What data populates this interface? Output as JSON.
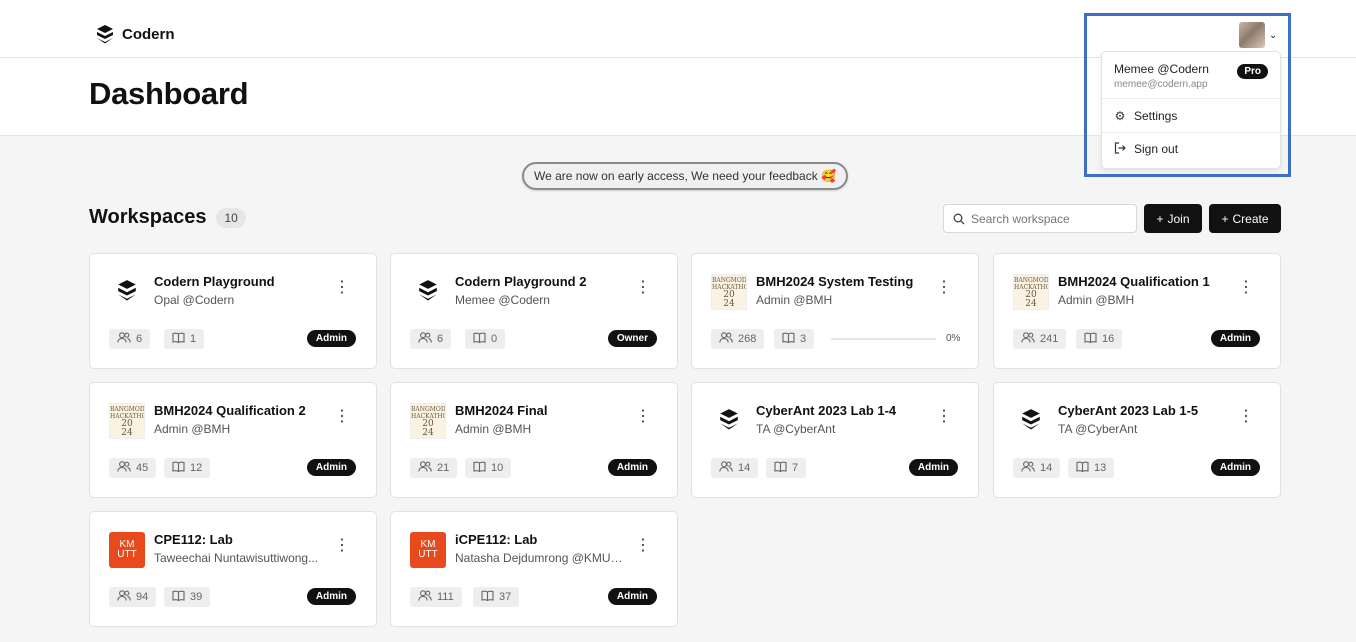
{
  "app": {
    "name": "Codern"
  },
  "page": {
    "title": "Dashboard"
  },
  "user_menu": {
    "name": "Memee @Codern",
    "email": "memee@codern.app",
    "badge": "Pro",
    "items": [
      {
        "label": "Settings",
        "icon": "gear-icon"
      },
      {
        "label": "Sign out",
        "icon": "sign-out-icon"
      }
    ]
  },
  "banner": {
    "text": "We are now on early access, We need your feedback 🥰"
  },
  "workspaces": {
    "title": "Workspaces",
    "count": "10",
    "search_placeholder": "Search workspace",
    "join_label": "Join",
    "create_label": "Create",
    "items": [
      {
        "name": "Codern Playground",
        "owner": "Opal @Codern",
        "members": "6",
        "problems": "1",
        "role": "Admin",
        "logo": "codern"
      },
      {
        "name": "Codern Playground 2",
        "owner": "Memee @Codern",
        "members": "6",
        "problems": "0",
        "role": "Owner",
        "logo": "codern"
      },
      {
        "name": "BMH2024 System Testing",
        "owner": "Admin @BMH",
        "members": "268",
        "problems": "3",
        "role": "",
        "progress": "0%",
        "progress_value": 0,
        "logo": "bmh"
      },
      {
        "name": "BMH2024 Qualification 1",
        "owner": "Admin @BMH",
        "members": "241",
        "problems": "16",
        "role": "Admin",
        "logo": "bmh"
      },
      {
        "name": "BMH2024 Qualification 2",
        "owner": "Admin @BMH",
        "members": "45",
        "problems": "12",
        "role": "Admin",
        "logo": "bmh"
      },
      {
        "name": "BMH2024 Final",
        "owner": "Admin @BMH",
        "members": "21",
        "problems": "10",
        "role": "Admin",
        "logo": "bmh"
      },
      {
        "name": "CyberAnt 2023 Lab 1-4",
        "owner": "TA @CyberAnt",
        "members": "14",
        "problems": "7",
        "role": "Admin",
        "logo": "codern"
      },
      {
        "name": "CyberAnt 2023 Lab 1-5",
        "owner": "TA @CyberAnt",
        "members": "14",
        "problems": "13",
        "role": "Admin",
        "logo": "codern"
      },
      {
        "name": "CPE112: Lab",
        "owner": "Taweechai Nuntawisuttiwong...",
        "members": "94",
        "problems": "39",
        "role": "Admin",
        "logo": "kmutt"
      },
      {
        "name": "iCPE112: Lab",
        "owner": "Natasha Dejdumrong @KMUTT",
        "members": "111",
        "problems": "37",
        "role": "Admin",
        "logo": "kmutt"
      }
    ]
  },
  "logo_text": {
    "bmh": [
      "BANGMOD",
      "HACKATHON",
      "20",
      "24"
    ],
    "kmutt": [
      "KM",
      "UTT"
    ]
  },
  "colors": {
    "accent": "#111111",
    "highlight": "#3e6fc7",
    "kmutt": "#e8491d"
  }
}
